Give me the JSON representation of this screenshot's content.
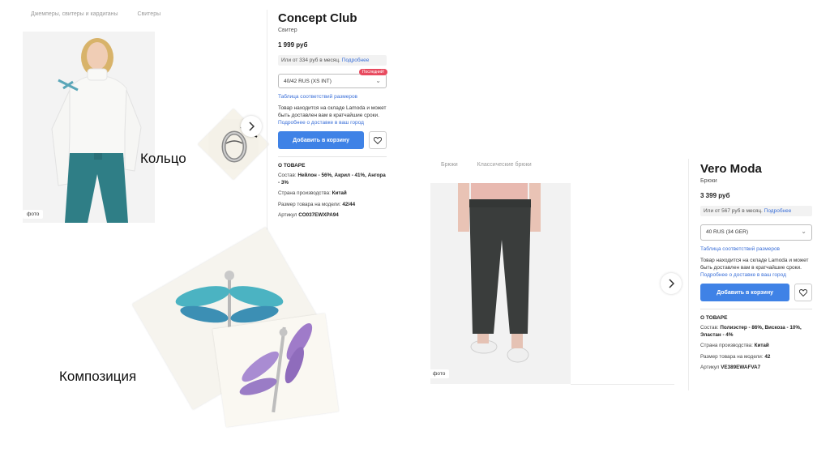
{
  "product1": {
    "breadcrumbs": [
      "Джемперы, свитеры и кардиганы",
      "Свитеры"
    ],
    "photo_badge": "фото",
    "brand": "Concept Club",
    "type": "Свитер",
    "price": "1 999 руб",
    "installment_text": "Или от 334 руб в месяц.",
    "installment_link": "Подробнее",
    "size": "40/42 RUS (XS INT)",
    "size_tag": "Последний!",
    "size_chart_link": "Таблица соответствий размеров",
    "stock_text": "Товар находится на складе Lamoda и может быть доставлен вам в кратчайшие сроки.",
    "delivery_link": "Подробнее о доставке в ваш город",
    "add_to_cart": "Добавить в корзину",
    "about_title": "О ТОВАРЕ",
    "composition_label": "Состав:",
    "composition_value": "Нейлон - 56%, Акрил - 41%, Ангора - 3%",
    "country_label": "Страна производства:",
    "country_value": "Китай",
    "model_size_label": "Размер товара на модели:",
    "model_size_value": "42/44",
    "sku_label": "Артикул",
    "sku_value": "CO037EWXPA94"
  },
  "product2": {
    "breadcrumbs": [
      "Брюки",
      "Классические брюки"
    ],
    "photo_badge": "фото",
    "brand": "Vero Moda",
    "type": "Брюки",
    "price": "3 399 руб",
    "installment_text": "Или от 567 руб в месяц.",
    "installment_link": "Подробнее",
    "size": "40 RUS (34 GER)",
    "size_chart_link": "Таблица соответствий размеров",
    "stock_text": "Товар находится на складе Lamoda и может быть доставлен вам в кратчайшие сроки.",
    "delivery_link": "Подробнее о доставке в ваш город",
    "add_to_cart": "Добавить в корзину",
    "about_title": "О ТОВАРЕ",
    "composition_label": "Состав:",
    "composition_value": "Полиэстер - 86%, Вискоза - 10%, Эластан - 4%",
    "country_label": "Страна производства:",
    "country_value": "Китай",
    "model_size_label": "Размер товара на модели:",
    "model_size_value": "42",
    "sku_label": "Артикул",
    "sku_value": "VE389EWAFVA7"
  },
  "labels": {
    "ring": "Кольцо",
    "composition": "Композиция"
  },
  "colors": {
    "accent": "#3f82e6",
    "link": "#3a6fd8",
    "tag": "#e84a5f"
  }
}
